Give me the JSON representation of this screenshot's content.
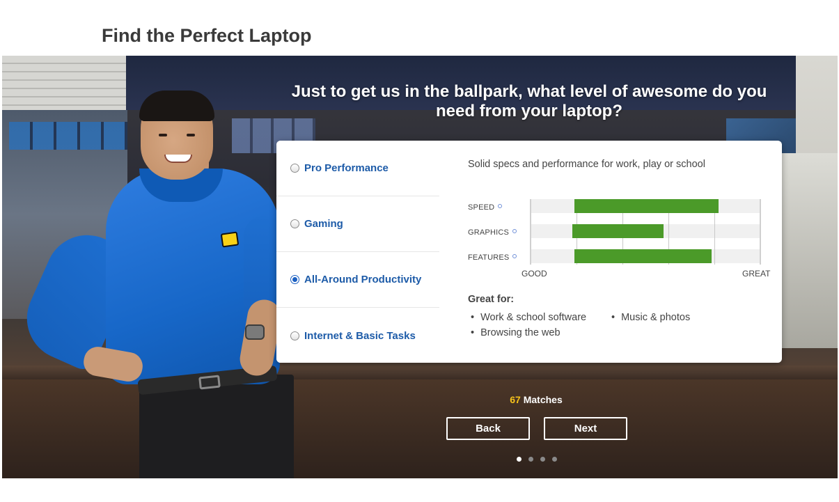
{
  "page": {
    "title": "Find the Perfect Laptop"
  },
  "quiz": {
    "question": "Just to get us in the ballpark, what level of awesome do you need from your laptop?",
    "options": [
      {
        "label": "Pro Performance",
        "selected": false
      },
      {
        "label": "Gaming",
        "selected": false
      },
      {
        "label": "All-Around Productivity",
        "selected": true
      },
      {
        "label": "Internet & Basic Tasks",
        "selected": false
      }
    ],
    "detail": {
      "description": "Solid specs and performance for work, play or school",
      "ratings": [
        {
          "label": "SPEED",
          "start": 0.19,
          "end": 0.82
        },
        {
          "label": "GRAPHICS",
          "start": 0.18,
          "end": 0.58
        },
        {
          "label": "FEATURES",
          "start": 0.19,
          "end": 0.79
        }
      ],
      "scale_low": "GOOD",
      "scale_high": "GREAT",
      "great_for_title": "Great for:",
      "great_for": [
        "Work & school software",
        "Music & photos",
        "Browsing the web"
      ]
    },
    "matches": {
      "count": "67",
      "label": "Matches"
    },
    "buttons": {
      "back": "Back",
      "next": "Next"
    },
    "progress": {
      "current_step": 1,
      "total_steps": 4
    }
  },
  "icons": {
    "radio": "radio-button-icon",
    "info": "info-icon"
  },
  "colors": {
    "bar": "#4b9a29",
    "option_text": "#1d5ba8",
    "matches_count": "#f6c21a"
  }
}
